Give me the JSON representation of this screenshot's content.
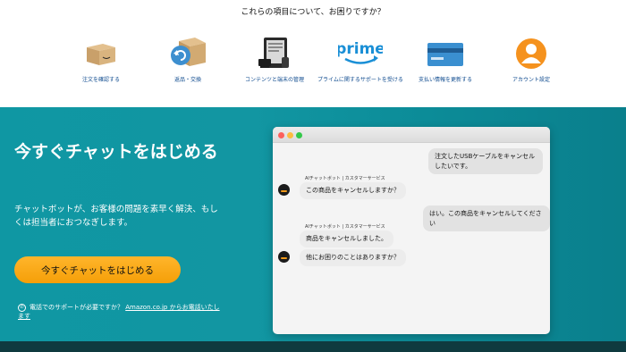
{
  "question": "これらの項目について、お困りですか？",
  "topics": [
    {
      "label": "注文を確認する",
      "icon": "box-icon"
    },
    {
      "label": "返品・交換",
      "icon": "return-box-icon"
    },
    {
      "label": "コンテンツと端末の管理",
      "icon": "devices-icon"
    },
    {
      "label": "プライムに関するサポートを受ける",
      "icon": "prime-logo-icon"
    },
    {
      "label": "支払い情報を更新する",
      "icon": "credit-card-icon"
    },
    {
      "label": "アカウント設定",
      "icon": "account-icon"
    }
  ],
  "prime_text": "prime",
  "hero": {
    "title": "今すぐチャットをはじめる",
    "description": "チャットボットが、お客様の問題を素早く解決、もしくは担当者におつなぎします。",
    "cta": "今すぐチャットをはじめる",
    "phone_text": "電話でのサポートが必要ですか？",
    "phone_link": "Amazon.co.jp からお電話いたします"
  },
  "chat": {
    "messages": [
      {
        "from": "user",
        "text": "注文したUSBケーブルをキャンセルしたいです。"
      },
      {
        "from": "bot",
        "meta": "AIチャットボット | カスタマーサービス",
        "text": "この商品をキャンセルしますか？"
      },
      {
        "from": "user",
        "text": "はい。この商品をキャンセルしてください"
      },
      {
        "from": "bot",
        "meta": "AIチャットボット | カスタマーサービス",
        "text": "商品をキャンセルしました。"
      },
      {
        "from": "bot",
        "text": "他にお困りのことはありますか？"
      }
    ]
  },
  "colors": {
    "hero_bg": "#1296a2",
    "cta": "#f8a61c",
    "link": "#0f4b8f",
    "prime": "#1a8fd6",
    "card": "#3a8fd0",
    "account": "#f5921e",
    "bottom_bar": "#0f3a3f"
  }
}
